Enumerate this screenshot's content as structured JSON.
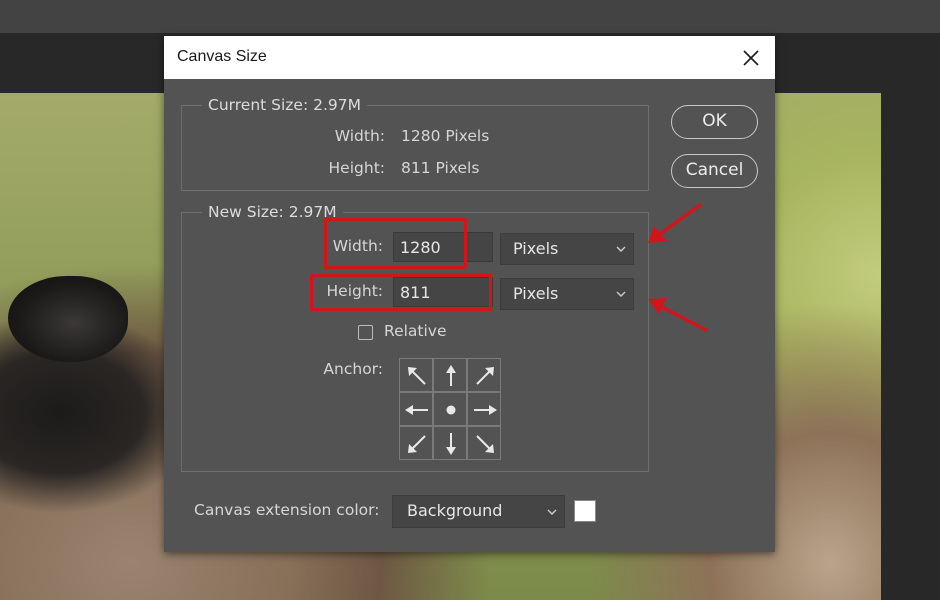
{
  "dialog": {
    "title": "Canvas Size",
    "current_size": {
      "legend": "Current Size: 2.97M",
      "width_label": "Width:",
      "width_value": "1280 Pixels",
      "height_label": "Height:",
      "height_value": "811 Pixels"
    },
    "new_size": {
      "legend": "New Size: 2.97M",
      "width_label": "Width:",
      "width_value": "1280",
      "width_unit": "Pixels",
      "height_label": "Height:",
      "height_value": "811",
      "height_unit": "Pixels",
      "relative_label": "Relative",
      "relative_checked": false,
      "anchor_label": "Anchor:",
      "anchor_selected": "center"
    },
    "extension": {
      "label": "Canvas extension color:",
      "value": "Background",
      "swatch_color": "#ffffff"
    },
    "buttons": {
      "ok": "OK",
      "cancel": "Cancel"
    }
  },
  "colors": {
    "annotation": "#d3141b",
    "dialog_bg": "#535353"
  }
}
